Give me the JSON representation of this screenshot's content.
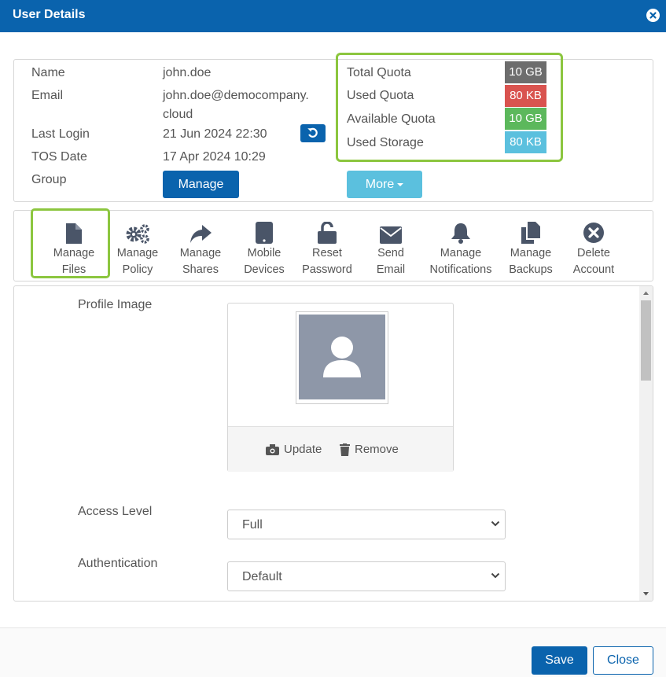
{
  "window": {
    "title": "User Details"
  },
  "user_info": {
    "name_label": "Name",
    "name_value": "john.doe",
    "email_label": "Email",
    "email_value_line1": "john.doe@democompany.",
    "email_value_line2": "cloud",
    "last_login_label": "Last Login",
    "last_login_value": "21 Jun 2024 22:30",
    "tos_label": "TOS Date",
    "tos_value": "17 Apr 2024 10:29",
    "group_label": "Group",
    "manage_button": "Manage",
    "more_button": "More"
  },
  "quota": {
    "total_label": "Total Quota",
    "total_value": "10 GB",
    "total_color": "#6d6d6d",
    "used_label": "Used Quota",
    "used_value": "80 KB",
    "used_color": "#d9534f",
    "available_label": "Available Quota",
    "available_value": "10 GB",
    "available_color": "#5cb85c",
    "storage_label": "Used Storage",
    "storage_value": "80 KB",
    "storage_color": "#5bc0de",
    "highlight_color": "#8cc63f"
  },
  "actions": [
    {
      "line1": "Manage",
      "line2": "Files",
      "icon": "file-icon"
    },
    {
      "line1": "Manage",
      "line2": "Policy",
      "icon": "gears-icon"
    },
    {
      "line1": "Manage",
      "line2": "Shares",
      "icon": "share-icon"
    },
    {
      "line1": "Mobile",
      "line2": "Devices",
      "icon": "tablet-icon"
    },
    {
      "line1": "Reset",
      "line2": "Password",
      "icon": "unlock-icon"
    },
    {
      "line1": "Send",
      "line2": "Email",
      "icon": "envelope-icon"
    },
    {
      "line1": "Manage",
      "line2": "Notifications",
      "icon": "bell-icon"
    },
    {
      "line1": "Manage",
      "line2": "Backups",
      "icon": "copy-icon"
    },
    {
      "line1": "Delete",
      "line2": "Account",
      "icon": "times-circle-icon"
    }
  ],
  "profile": {
    "image_label": "Profile Image",
    "update_label": "Update",
    "remove_label": "Remove",
    "access_level_label": "Access Level",
    "access_level_value": "Full",
    "authentication_label": "Authentication",
    "authentication_value": "Default"
  },
  "footer": {
    "save": "Save",
    "close": "Close"
  },
  "colors": {
    "primary": "#0a63ad",
    "info": "#5bc0de",
    "icon": "#4a5568"
  }
}
